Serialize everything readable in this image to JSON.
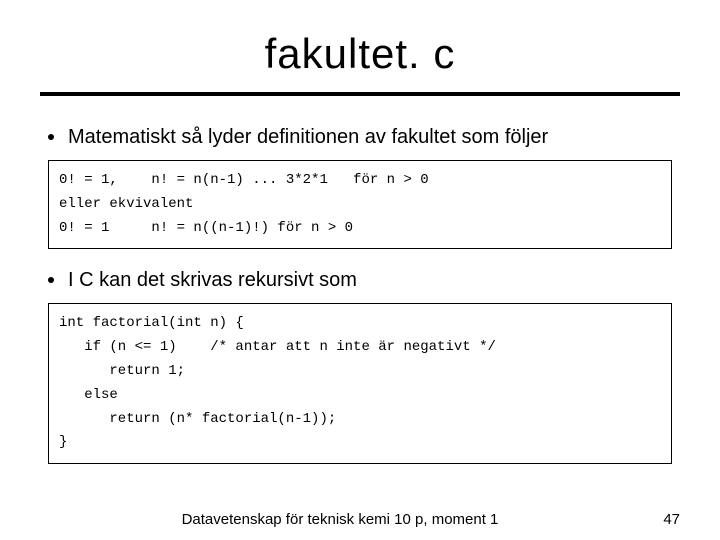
{
  "title": "fakultet. c",
  "bullets": [
    "Matematiskt så lyder definitionen av fakultet som följer",
    "I C kan det skrivas rekursivt som"
  ],
  "codebox1": {
    "line1": "0! = 1,    n! = n(n-1) ... 3*2*1   för n > 0",
    "line2": "eller ekvivalent",
    "line3": "0! = 1     n! = n((n-1)!) för n > 0"
  },
  "codebox2": {
    "l1": "int factorial(int n) {",
    "l2": "   if (n <= 1)    /* antar att n inte är negativt */",
    "l3": "      return 1;",
    "l4": "   else",
    "l5": "      return (n* factorial(n-1));",
    "l6": "}"
  },
  "footer": {
    "text": "Datavetenskap för teknisk kemi 10 p, moment 1",
    "page": "47"
  }
}
